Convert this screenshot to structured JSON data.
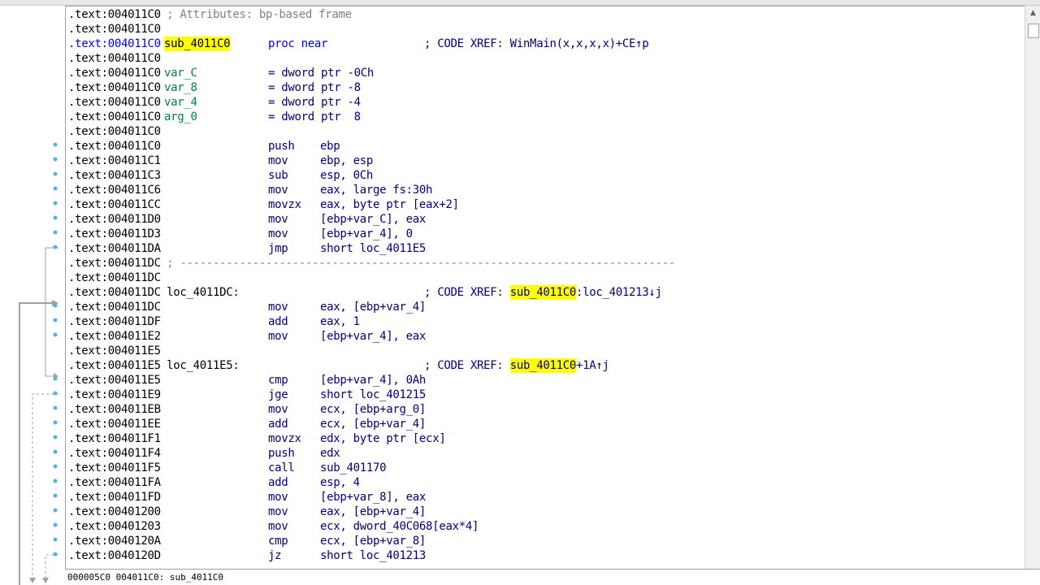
{
  "listing": {
    "lines": [
      {
        "addr": ".text:004011C0",
        "rest": " ; Attributes: bp-based frame",
        "rest_color": "gray"
      },
      {
        "addr": ".text:004011C0"
      },
      {
        "addr": ".text:004011C0",
        "addr_color": "blue",
        "label": "sub_4011C0",
        "label_hl": true,
        "mnem": "proc near",
        "mnem_color": "blue",
        "comment": "; CODE XREF: WinMain(x,x,x,x)+CE↑p"
      },
      {
        "addr": ".text:004011C0"
      },
      {
        "addr": ".text:004011C0",
        "label": "var_C",
        "label_color": "green",
        "mnem": "= dword ptr -0Ch"
      },
      {
        "addr": ".text:004011C0",
        "label": "var_8",
        "label_color": "green",
        "mnem": "= dword ptr -8"
      },
      {
        "addr": ".text:004011C0",
        "label": "var_4",
        "label_color": "green",
        "mnem": "= dword ptr -4"
      },
      {
        "addr": ".text:004011C0",
        "label": "arg_0",
        "label_color": "green",
        "mnem": "= dword ptr  8"
      },
      {
        "addr": ".text:004011C0"
      },
      {
        "addr": ".text:004011C0",
        "mnem": "push",
        "ops": "ebp",
        "dot": true
      },
      {
        "addr": ".text:004011C1",
        "mnem": "mov",
        "ops": "ebp, esp",
        "dot": true
      },
      {
        "addr": ".text:004011C3",
        "mnem": "sub",
        "ops": "esp, 0Ch",
        "dot": true
      },
      {
        "addr": ".text:004011C6",
        "mnem": "mov",
        "ops": "eax, large fs:30h",
        "dot": true
      },
      {
        "addr": ".text:004011CC",
        "mnem": "movzx",
        "ops": "eax, byte ptr [eax+2]",
        "dot": true
      },
      {
        "addr": ".text:004011D0",
        "mnem": "mov",
        "ops": "[ebp+var_C], eax",
        "dot": true
      },
      {
        "addr": ".text:004011D3",
        "mnem": "mov",
        "ops": "[ebp+var_4], 0",
        "dot": true
      },
      {
        "addr": ".text:004011DA",
        "mnem": "jmp",
        "ops": "short loc_4011E5",
        "dot": true
      },
      {
        "addr": ".text:004011DC",
        "rest": " ; ---------------------------------------------------------------------------",
        "rest_color": "gray"
      },
      {
        "addr": ".text:004011DC"
      },
      {
        "addr": ".text:004011DC",
        "label": " loc_4011DC:",
        "comment_pre": "; CODE XREF: ",
        "comment_hl": "sub_4011C0",
        "comment_post": ":loc_401213↓j"
      },
      {
        "addr": ".text:004011DC",
        "mnem": "mov",
        "ops": "eax, [ebp+var_4]",
        "dot": true
      },
      {
        "addr": ".text:004011DF",
        "mnem": "add",
        "ops": "eax, 1",
        "dot": true
      },
      {
        "addr": ".text:004011E2",
        "mnem": "mov",
        "ops": "[ebp+var_4], eax",
        "dot": true
      },
      {
        "addr": ".text:004011E5"
      },
      {
        "addr": ".text:004011E5",
        "label": " loc_4011E5:",
        "comment_pre": "; CODE XREF: ",
        "comment_hl": "sub_4011C0",
        "comment_post": "+1A↑j"
      },
      {
        "addr": ".text:004011E5",
        "mnem": "cmp",
        "ops": "[ebp+var_4], 0Ah",
        "dot": true
      },
      {
        "addr": ".text:004011E9",
        "mnem": "jge",
        "ops": "short loc_401215",
        "dot": true
      },
      {
        "addr": ".text:004011EB",
        "mnem": "mov",
        "ops": "ecx, [ebp+arg_0]",
        "dot": true
      },
      {
        "addr": ".text:004011EE",
        "mnem": "add",
        "ops": "ecx, [ebp+var_4]",
        "dot": true
      },
      {
        "addr": ".text:004011F1",
        "mnem": "movzx",
        "ops": "edx, byte ptr [ecx]",
        "dot": true
      },
      {
        "addr": ".text:004011F4",
        "mnem": "push",
        "ops": "edx",
        "dot": true
      },
      {
        "addr": ".text:004011F5",
        "mnem": "call",
        "ops": "sub_401170",
        "dot": true
      },
      {
        "addr": ".text:004011FA",
        "mnem": "add",
        "ops": "esp, 4",
        "dot": true
      },
      {
        "addr": ".text:004011FD",
        "mnem": "mov",
        "ops": "[ebp+var_8], eax",
        "dot": true
      },
      {
        "addr": ".text:00401200",
        "mnem": "mov",
        "ops": "eax, [ebp+var_4]",
        "dot": true
      },
      {
        "addr": ".text:00401203",
        "mnem": "mov",
        "ops": "ecx, dword_40C068[eax*4]",
        "dot": true
      },
      {
        "addr": ".text:0040120A",
        "mnem": "cmp",
        "ops": "ecx, [ebp+var_8]",
        "dot": true
      },
      {
        "addr": ".text:0040120D",
        "mnem": "jz",
        "ops": "short loc_401213",
        "dot": true
      }
    ]
  },
  "statusbar": {
    "text": "000005C0 004011C0: sub_4011C0"
  },
  "scrollbar": {
    "up_icon": "▲"
  },
  "colors": {
    "black": "#000000",
    "navy": "#000080",
    "blue": "#0000ff",
    "green": "#008040",
    "gray": "#808080",
    "highlight": "#ffff00",
    "dot": "#4fb3e8",
    "arrow_solid": "#a0a0a0",
    "arrow_dashed": "#a0a0a0"
  }
}
